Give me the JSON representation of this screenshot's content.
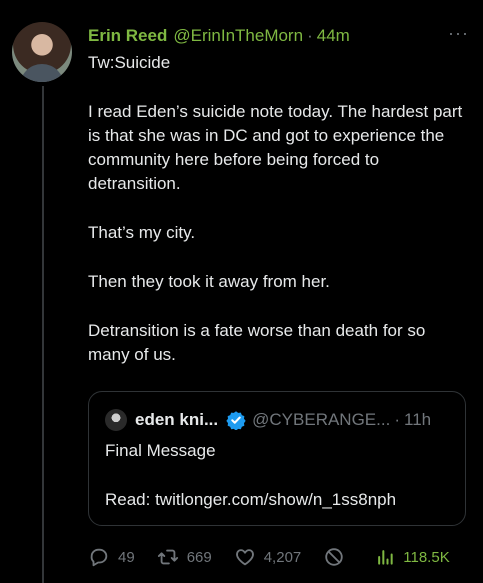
{
  "tweet": {
    "author_name": "Erin Reed",
    "author_handle": "@ErinInTheMorn",
    "separator": "·",
    "time": "44m",
    "more": "···",
    "paragraphs": [
      "Tw:Suicide",
      "I read Eden’s suicide note today. The hardest part is that she was in DC and got to experience the community here before being forced to detransition.",
      "That’s my city.",
      "Then they took it away from her.",
      "Detransition is a fate worse than death for so many of us."
    ]
  },
  "quote": {
    "author_name": "eden kni...",
    "author_handle": "@CYBERANGE...",
    "separator": "·",
    "time": "11h",
    "lines": [
      "Final Message",
      "Read: twitlonger.com/show/n_1ss8nph"
    ]
  },
  "actions": {
    "replies": "49",
    "retweets": "669",
    "likes": "4,207",
    "views": "118.5K"
  },
  "colors": {
    "accent": "#7fb842",
    "muted": "#71767b",
    "verified": "#1d9bf0"
  },
  "icons": [
    "more-icon",
    "verified-icon",
    "reply-icon",
    "retweet-icon",
    "like-icon",
    "block-icon",
    "views-icon"
  ]
}
